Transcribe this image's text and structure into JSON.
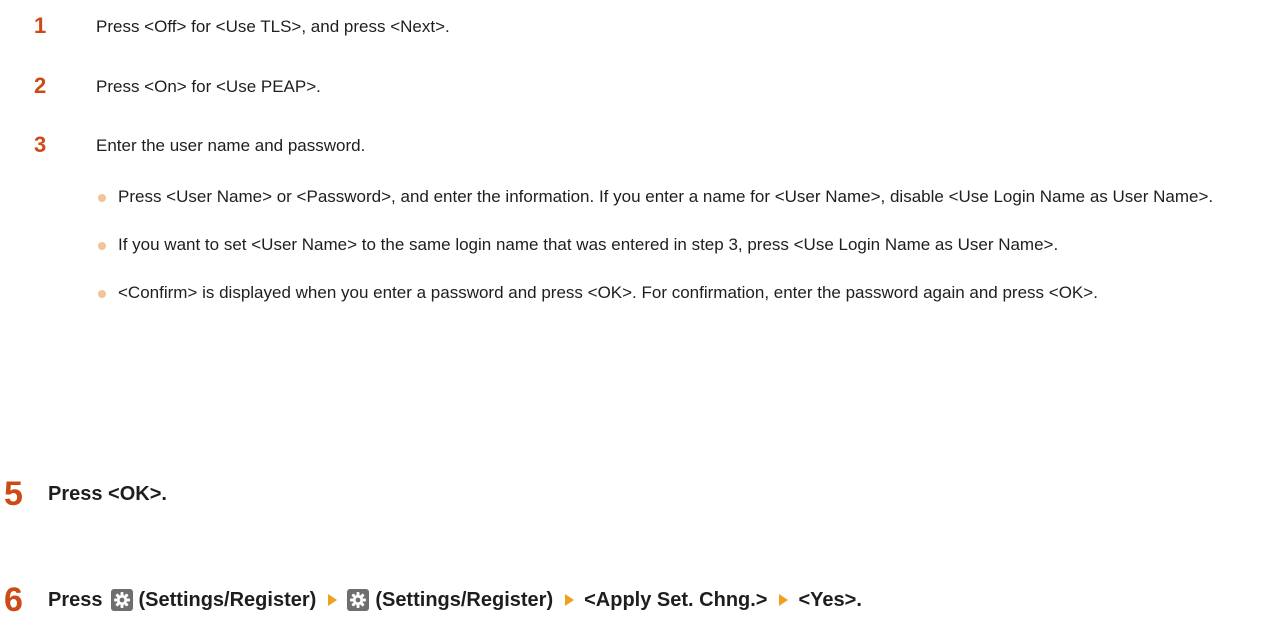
{
  "substeps": [
    {
      "number": "1",
      "text": "Press <Off> for <Use TLS>, and press <Next>."
    },
    {
      "number": "2",
      "text": "Press <On> for <Use PEAP>."
    },
    {
      "number": "3",
      "text": "Enter the user name and password."
    }
  ],
  "bullets": [
    "Press <User Name> or <Password>, and enter the information. If you enter a name for <User Name>, disable <Use Login Name as User Name>.",
    "If you want to set <User Name> to the same login name that was entered in step 3, press <Use Login Name as User Name>.",
    "<Confirm> is displayed when you enter a password and press <OK>. For confirmation, enter the password again and press <OK>."
  ],
  "step5": {
    "number": "5",
    "text": "Press <OK>."
  },
  "step6": {
    "number": "6",
    "press": "Press",
    "settings1": "(Settings/Register)",
    "settings2": "(Settings/Register)",
    "apply": "<Apply Set. Chng.>",
    "yes": "<Yes>."
  },
  "colors": {
    "accent": "#cc4a15",
    "bullet": "#f2c49a",
    "arrow": "#f0a020",
    "icon_bg": "#6e6e6e"
  },
  "icons": [
    "settings-register-icon",
    "arrow-right-icon"
  ]
}
